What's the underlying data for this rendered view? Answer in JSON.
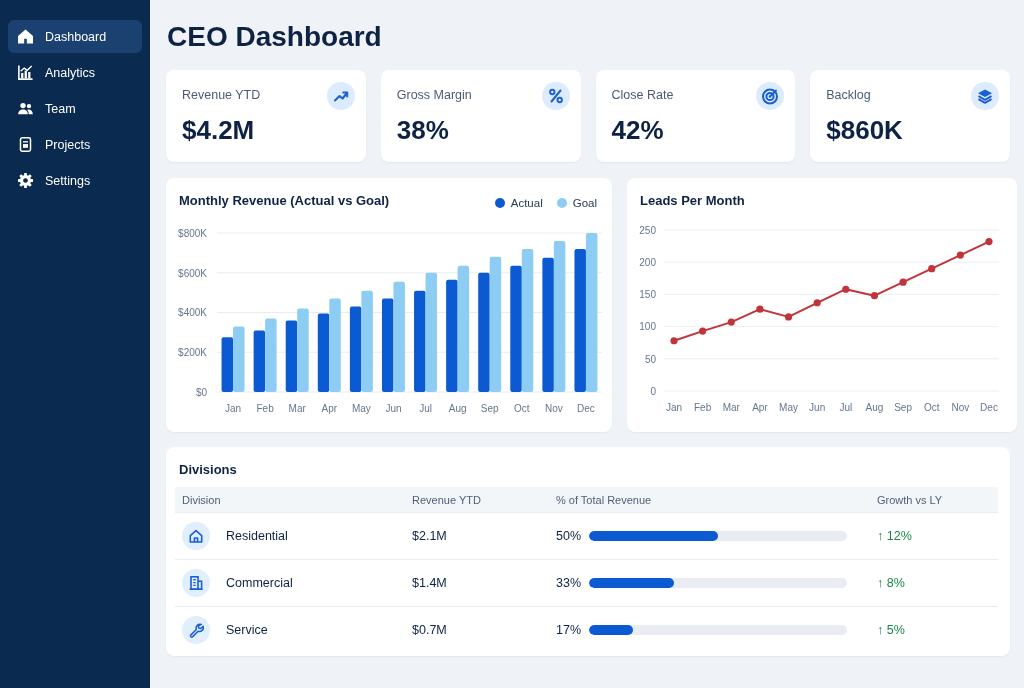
{
  "sidebar": {
    "items": [
      {
        "label": "Dashboard",
        "selected": true
      },
      {
        "label": "Analytics",
        "selected": false
      },
      {
        "label": "Team",
        "selected": false
      },
      {
        "label": "Projects",
        "selected": false
      },
      {
        "label": "Settings",
        "selected": false
      }
    ]
  },
  "header": {
    "title": "CEO Dashboard"
  },
  "kpi_cards": [
    {
      "label": "Revenue YTD",
      "value": "$4.2M"
    },
    {
      "label": "Gross Margin",
      "value": "38%"
    },
    {
      "label": "Close Rate",
      "value": "42%"
    },
    {
      "label": "Backlog",
      "value": "$860K"
    }
  ],
  "revenue_chart": {
    "chart_data": {
      "type": "bar",
      "title": "Monthly Revenue (Actual vs Goal)",
      "categories": [
        "Jan",
        "Feb",
        "Mar",
        "Apr",
        "May",
        "Jun",
        "Jul",
        "Aug",
        "Sep",
        "Oct",
        "Nov",
        "Dec"
      ],
      "series": [
        {
          "name": "Actual",
          "color": "#0b5ad2",
          "values": [
            275000,
            310000,
            360000,
            395000,
            430000,
            470000,
            510000,
            565000,
            600000,
            635000,
            675000,
            720000
          ]
        },
        {
          "name": "Goal",
          "color": "#8ecdf3",
          "values": [
            330000,
            370000,
            420000,
            470000,
            510000,
            555000,
            600000,
            635000,
            680000,
            720000,
            760000,
            800000
          ]
        }
      ],
      "ylim": [
        0,
        800000
      ],
      "yticks": [
        {
          "value": 0,
          "label": "$0"
        },
        {
          "value": 200000,
          "label": "$200K"
        },
        {
          "value": 400000,
          "label": "$400K"
        },
        {
          "value": 600000,
          "label": "$600K"
        },
        {
          "value": 800000,
          "label": "$800K"
        }
      ],
      "grid": true
    }
  },
  "leads_chart": {
    "chart_data": {
      "type": "line",
      "title": "Leads Per Month",
      "categories": [
        "Jan",
        "Feb",
        "Mar",
        "Apr",
        "May",
        "Jun",
        "Jul",
        "Aug",
        "Sep",
        "Oct",
        "Nov",
        "Dec"
      ],
      "values": [
        78,
        93,
        107,
        127,
        115,
        137,
        158,
        148,
        169,
        190,
        211,
        232
      ],
      "ylim": [
        0,
        250
      ],
      "yticks": [
        0,
        50,
        100,
        150,
        200,
        250
      ],
      "grid": true,
      "marker": "circle"
    }
  },
  "divisions": {
    "title": "Divisions",
    "columns": [
      "Division",
      "Revenue YTD",
      "% of Total Revenue",
      "Growth vs LY"
    ],
    "rows": [
      {
        "division": "Residential",
        "revenue_ytd": "$2.1M",
        "share": "50%",
        "level": 0.5,
        "growth": "↑ 12%"
      },
      {
        "division": "Commercial",
        "revenue_ytd": "$1.4M",
        "share": "33%",
        "level": 0.33,
        "growth": "↑ 8%"
      },
      {
        "division": "Service",
        "revenue_ytd": "$0.7M",
        "share": "17%",
        "level": 0.17,
        "growth": "↑ 5%"
      }
    ]
  }
}
